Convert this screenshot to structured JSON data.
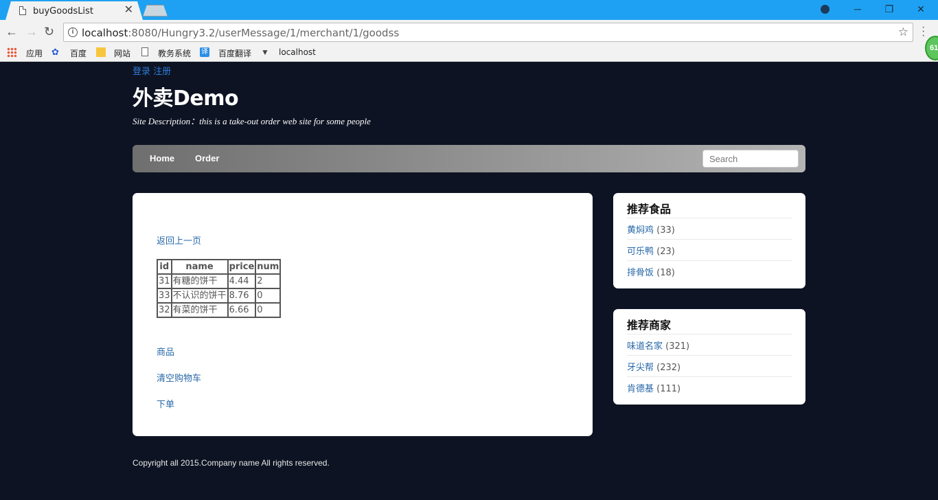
{
  "browser": {
    "tab_title": "buyGoodsList",
    "url_host": "localhost",
    "url_rest": ":8080/Hungry3.2/userMessage/1/merchant/1/goodss",
    "ext_badge": "61",
    "bookmarks": [
      "应用",
      "百度",
      "网站",
      "教务系统",
      "百度翻译",
      "localhost"
    ]
  },
  "header": {
    "login": "登录",
    "register": "注册",
    "site_title": "外卖Demo",
    "site_description": "Site Description：this is a take-out order web site for some people"
  },
  "nav": {
    "home": "Home",
    "order": "Order",
    "search_placeholder": "Search"
  },
  "main": {
    "back_link": "返回上一页",
    "table": {
      "columns": [
        "id",
        "name",
        "price",
        "num"
      ],
      "rows": [
        [
          "31",
          "有糖的饼干",
          "4.44",
          "2"
        ],
        [
          "33",
          "不认识的饼干",
          "8.76",
          "0"
        ],
        [
          "32",
          "有菜的饼干",
          "6.66",
          "0"
        ]
      ]
    },
    "goods_link": "商品",
    "clear_cart_link": "清空购物车",
    "place_order_link": "下单"
  },
  "sidebar": {
    "food": {
      "title": "推荐食品",
      "items": [
        {
          "name": "黄焖鸡",
          "count": "(33)"
        },
        {
          "name": "可乐鸭",
          "count": "(23)"
        },
        {
          "name": "排骨饭",
          "count": "(18)"
        }
      ]
    },
    "merchants": {
      "title": "推荐商家",
      "items": [
        {
          "name": "味道名家",
          "count": "(321)"
        },
        {
          "name": "牙尖帮",
          "count": "(232)"
        },
        {
          "name": "肯德基",
          "count": "(111)"
        }
      ]
    }
  },
  "footer": {
    "copyright": "Copyright all 2015.Company name All rights reserved."
  }
}
